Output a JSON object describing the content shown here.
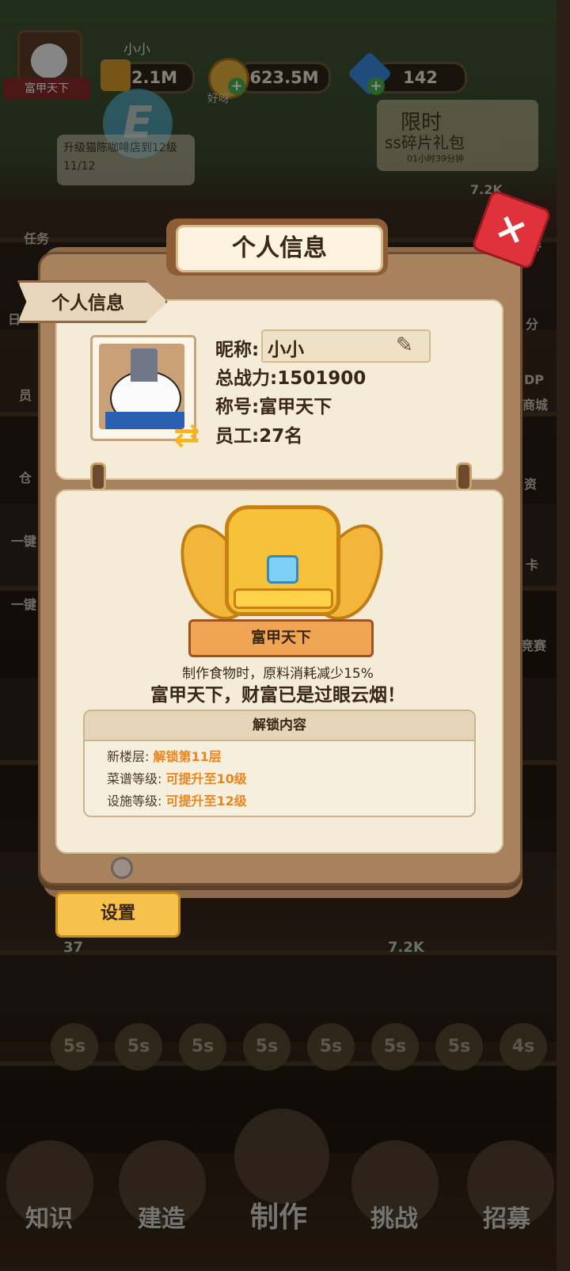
{
  "hud": {
    "title_badge": "富甲天下",
    "player_name": "小小",
    "power": "2.1M",
    "coins": "623.5M",
    "gems": "142",
    "plus": "+",
    "hud_sign": "好呀",
    "quest_text": "升级猫陈咖啡店到12级",
    "quest_progress": "11/12",
    "promo_line1": "限时",
    "promo_line2": "ss碎片礼包",
    "promo_timer": "01小时39分钟"
  },
  "side_right": [
    "7.2K",
    "春",
    "分",
    "DP",
    "商城",
    "资",
    "卡",
    "竞赛"
  ],
  "side_left": [
    "任务",
    "日",
    "员",
    "仓",
    "一键",
    "一键"
  ],
  "panel": {
    "title": "个人信息",
    "tab": "个人信息",
    "close": "×",
    "nickname_label": "昵称:",
    "nickname": "小小",
    "power_line": "总战力:1501900",
    "title_line": "称号:富甲天下",
    "staff_line": "员工:27名"
  },
  "emblem": {
    "name": "富甲天下",
    "effect": "制作食物时，原料消耗减少15%",
    "motto": "富甲天下，财富已是过眼云烟！"
  },
  "unlock": {
    "header": "解锁内容",
    "rows": [
      {
        "label": "新楼层:",
        "value": "解锁第11层"
      },
      {
        "label": "菜谱等级:",
        "value": "可提升至10级"
      },
      {
        "label": "设施等级:",
        "value": "可提升至12级"
      }
    ]
  },
  "settings_button": "设置",
  "badges": {
    "left": "37",
    "right": "7.2K"
  },
  "timers": [
    "5s",
    "5s",
    "5s",
    "5s",
    "5s",
    "5s",
    "5s",
    "4s"
  ],
  "bottom_nav": [
    "知识",
    "建造",
    "制作",
    "挑战",
    "招募"
  ],
  "colors": {
    "accent": "#e9861f",
    "close": "#e0323a",
    "panel": "#a8825c",
    "card": "#f5ecd7",
    "button": "#f6c24b"
  }
}
